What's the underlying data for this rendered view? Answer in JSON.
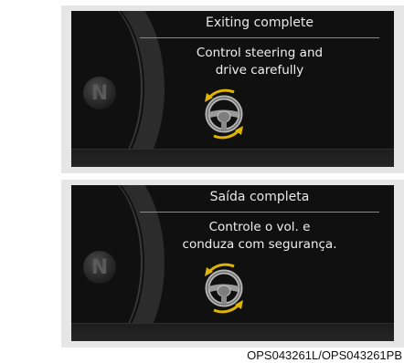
{
  "colors": {
    "screen_bg": "#101010",
    "panel_bg": "#e6e6e6",
    "text": "#f0f0f0",
    "arrow_accent": "#e0b400"
  },
  "gear_indicator": "N",
  "screens": [
    {
      "title": "Exiting complete",
      "body_line1": "Control steering and",
      "body_line2": "drive carefully",
      "icon": "steering-wheel-icon"
    },
    {
      "title": "Saída completa",
      "body_line1": "Controle o vol. e",
      "body_line2": "conduza com segurança.",
      "icon": "steering-wheel-icon"
    }
  ],
  "caption": "OPS043261L/OPS043261PB"
}
